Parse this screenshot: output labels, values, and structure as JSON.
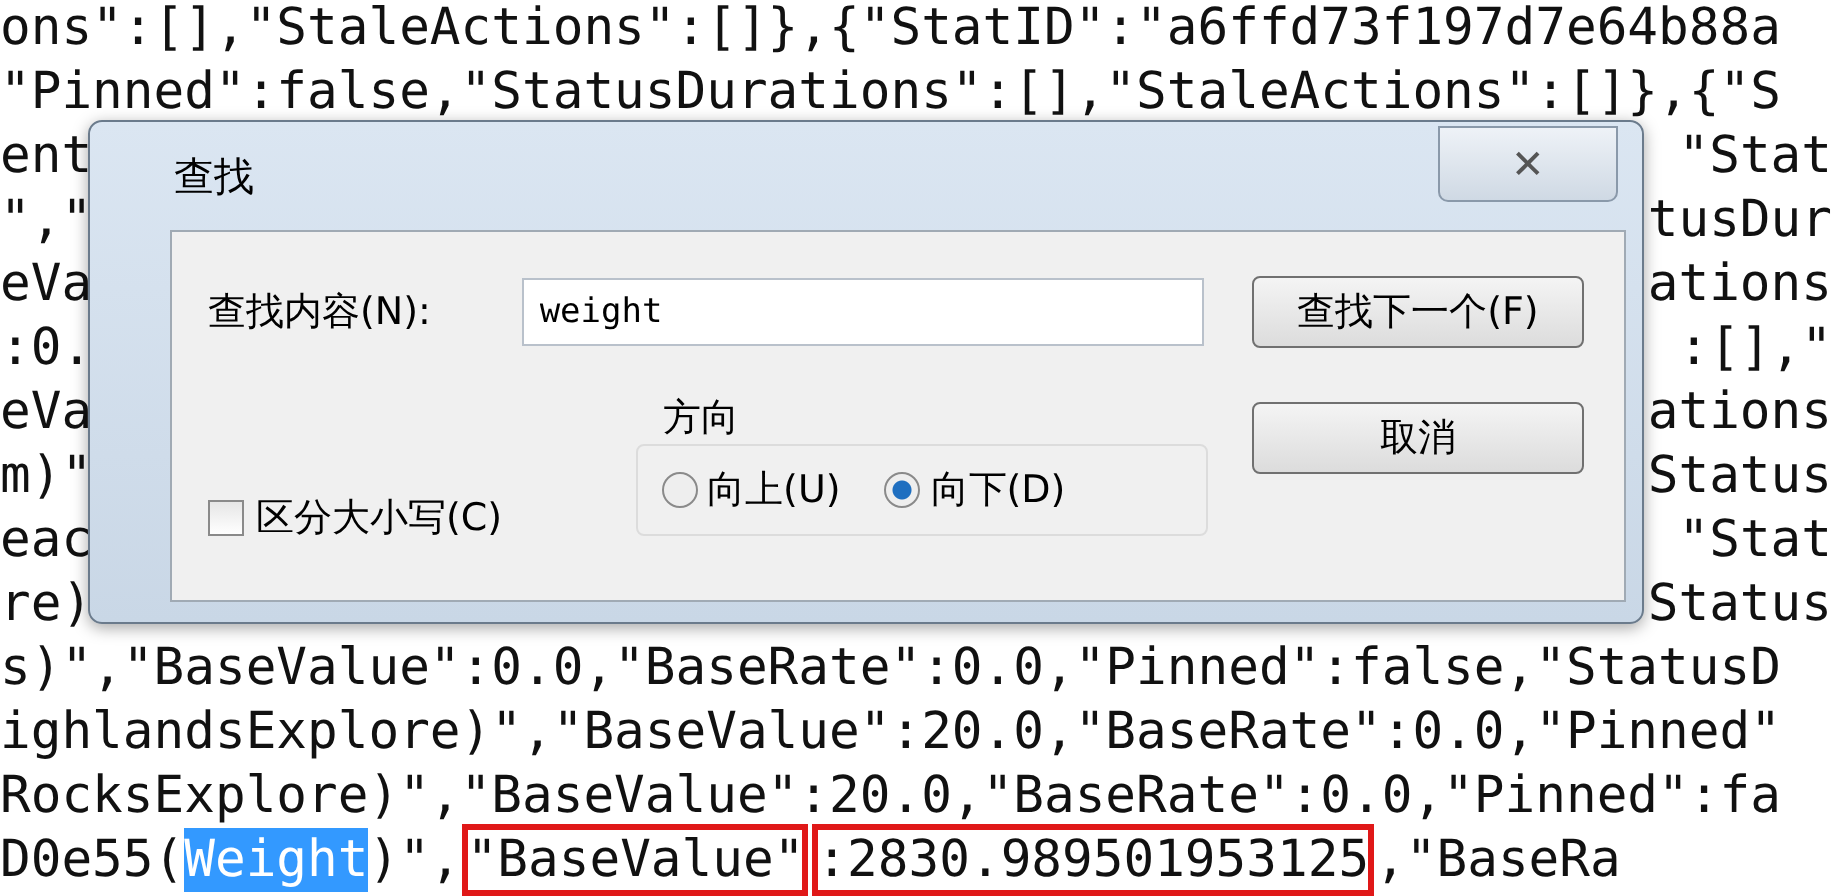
{
  "editor": {
    "lines": [
      {
        "kind": "full",
        "segments": [
          {
            "text": "ons\":[],\"StaleActions\":[]},{\"StatID\":\"a6ffd73f197d7e64b88a",
            "kind": "plain"
          }
        ]
      },
      {
        "kind": "full",
        "segments": [
          {
            "text": "\"Pinned\":false,\"StatusDurations\":[],\"StaleActions\":[]},{\"S",
            "kind": "plain"
          }
        ]
      },
      {
        "kind": "split",
        "left": "ent",
        "right": "\"Stat"
      },
      {
        "kind": "split",
        "left": "\",\"",
        "right": "tusDur"
      },
      {
        "kind": "split",
        "left": "eVa",
        "right": "ations"
      },
      {
        "kind": "split",
        "left": ":0.",
        "right": ":[],\""
      },
      {
        "kind": "split",
        "left": "eVa",
        "right": "ations"
      },
      {
        "kind": "split",
        "left": "m)\"",
        "right": "Status"
      },
      {
        "kind": "split",
        "left": "eac",
        "right": "\"Stat"
      },
      {
        "kind": "split",
        "left": "re)",
        "right": "Status"
      },
      {
        "kind": "full",
        "segments": [
          {
            "text": "s)\",\"BaseValue\":0.0,\"BaseRate\":0.0,\"Pinned\":false,\"StatusD",
            "kind": "plain"
          }
        ]
      },
      {
        "kind": "full",
        "segments": [
          {
            "text": "ighlandsExplore)\",\"BaseValue\":20.0,\"BaseRate\":0.0,\"Pinned\"",
            "kind": "plain"
          }
        ]
      },
      {
        "kind": "full",
        "segments": [
          {
            "text": "RocksExplore)\",\"BaseValue\":20.0,\"BaseRate\":0.0,\"Pinned\":fa",
            "kind": "plain"
          }
        ]
      },
      {
        "kind": "full",
        "segments": [
          {
            "text": "D0e55(",
            "kind": "plain"
          },
          {
            "text": "Weight",
            "kind": "highlight"
          },
          {
            "text": ")\",",
            "kind": "plain"
          },
          {
            "text": "\"BaseValue\"",
            "kind": "boxed"
          },
          {
            "text": ":2830.989501953125",
            "kind": "boxed"
          },
          {
            "text": ",\"BaseRa",
            "kind": "plain"
          }
        ]
      }
    ]
  },
  "dialog": {
    "title": "查找",
    "close": "✕",
    "find_label": "查找内容(N):",
    "find_value": "weight",
    "find_next_button": "查找下一个(F)",
    "cancel_button": "取消",
    "match_case": {
      "label": "区分大小写(C)",
      "checked": false
    },
    "direction": {
      "title": "方向",
      "options": [
        {
          "label": "向上(U)",
          "selected": false
        },
        {
          "label": "向下(D)",
          "selected": true
        }
      ]
    }
  }
}
